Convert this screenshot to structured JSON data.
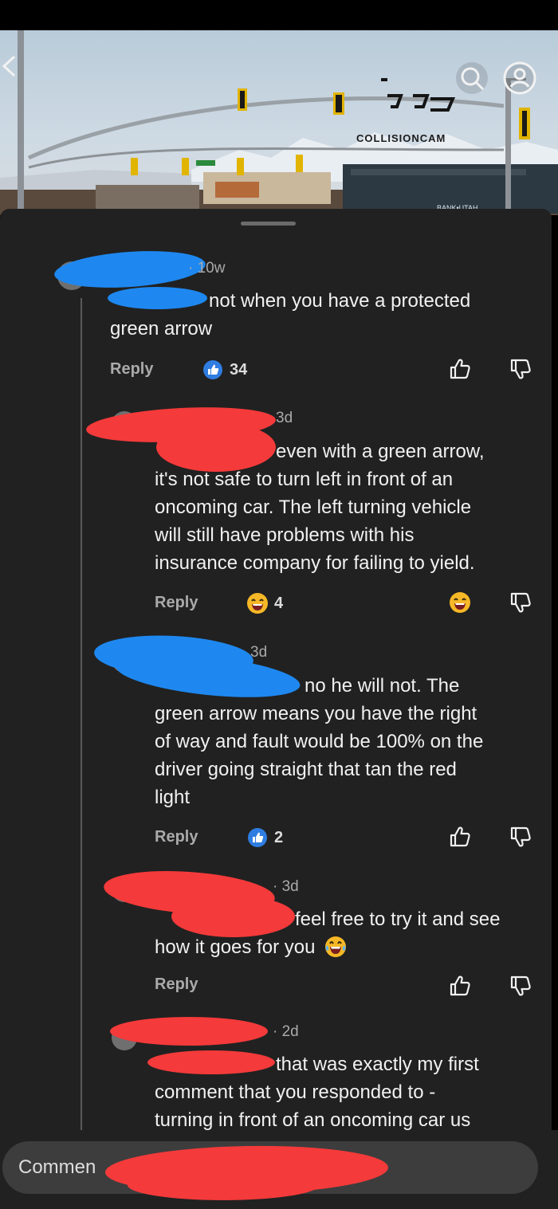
{
  "video": {
    "watermark": "COLLISIONCAM",
    "bank_sign": "BANK•UTAH"
  },
  "comments": [
    {
      "time": "10w",
      "text_line1": "not when you have a protected",
      "text_line2": "green arrow",
      "reply_label": "Reply",
      "like_count": "34"
    },
    {
      "time": "3d",
      "text_line1": "even with a green arrow,",
      "text_line2": "it's not safe to turn left in front of an",
      "text_line3": "oncoming car. The left turning vehicle",
      "text_line4": "will still have problems with his",
      "text_line5": "insurance company for failing to yield.",
      "reply_label": "Reply",
      "reaction_count": "4"
    },
    {
      "time": "3d",
      "text_line1": "no he will not.  The",
      "text_line2": "green arrow means you have the right",
      "text_line3": "of way and fault would be 100% on the",
      "text_line4": "driver going straight that tan the red",
      "text_line5": "light",
      "reply_label": "Reply",
      "like_count": "2"
    },
    {
      "time": "3d",
      "text_line1": "feel free to try it and see",
      "text_line2": "how it goes for you",
      "reply_label": "Reply"
    },
    {
      "time": "2d",
      "text_line1": "that was exactly my first",
      "text_line2": "comment that you responded to -",
      "text_line3": "turning in front of an oncoming car us"
    }
  ],
  "composer": {
    "placeholder": "Commen"
  },
  "colors": {
    "sheet_bg": "#212121",
    "redaction_blue": "#1e88f0",
    "redaction_red": "#f43a3a",
    "like_badge_blue": "#2f7de1"
  }
}
